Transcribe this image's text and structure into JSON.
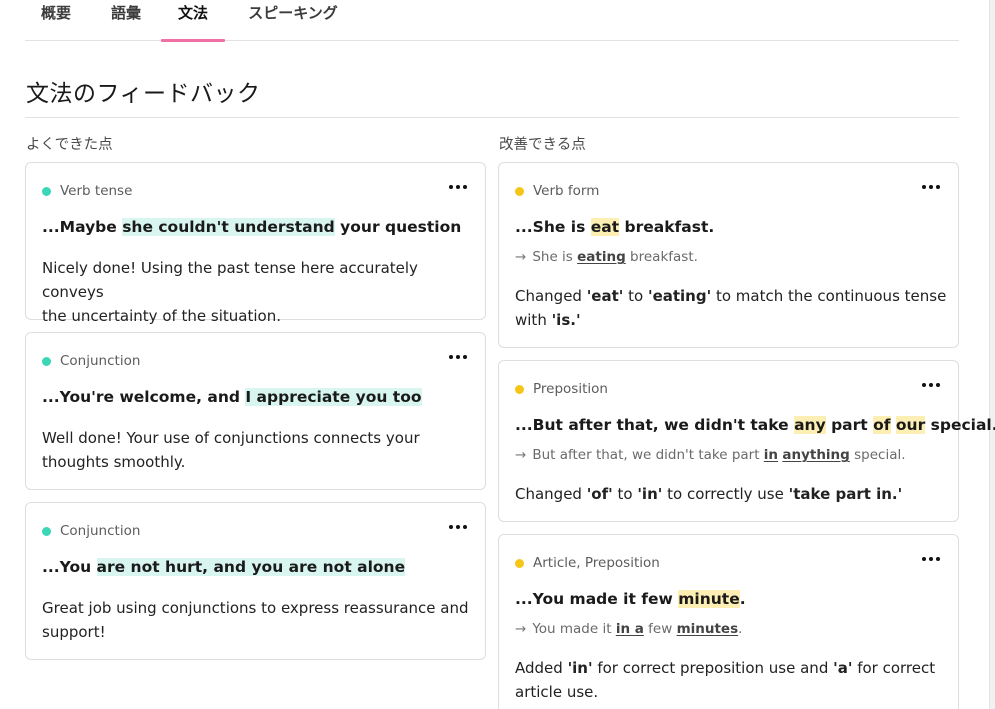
{
  "tabs": [
    "概要",
    "語彙",
    "文法",
    "スピーキング"
  ],
  "active_tab": "文法",
  "page_title": "文法のフィードバック",
  "good_heading": "よくできた点",
  "improve_heading": "改善できる点",
  "good_cards": [
    {
      "category": "Verb tense",
      "quote_prefix": "...Maybe ",
      "quote_highlight": "she couldn't understand",
      "quote_suffix": " your question",
      "feedback_line1": "Nicely done! Using the past tense here accurately conveys",
      "feedback_line2": "the uncertainty of the situation."
    },
    {
      "category": "Conjunction",
      "quote_prefix": "...You're welcome, and ",
      "quote_highlight": "I appreciate you too",
      "quote_suffix": "",
      "feedback_line1": "Well done! Your use of conjunctions connects your",
      "feedback_line2": "thoughts smoothly."
    },
    {
      "category": "Conjunction",
      "quote_prefix": "...You ",
      "quote_highlight": "are not hurt, and you are not alone",
      "quote_suffix": "",
      "feedback_line1": "Great job using conjunctions to express reassurance and",
      "feedback_line2": "support!"
    }
  ],
  "improve_cards": [
    {
      "category": "Verb form",
      "quote": [
        "...She is ",
        "eat",
        " breakfast."
      ],
      "correction": [
        "She is ",
        "eating",
        " breakfast."
      ],
      "feedback_line1": [
        "Changed ",
        "'eat'",
        " to ",
        "'eating'",
        " to match the continuous tense"
      ],
      "feedback_line2": [
        "with ",
        "'is.'"
      ]
    },
    {
      "category": "Preposition",
      "quote": [
        "...But after that, we didn't take ",
        "any",
        " part ",
        "of",
        " ",
        "our",
        " special."
      ],
      "correction": [
        "But after that, we didn't take part ",
        "in",
        " ",
        "anything",
        " special."
      ],
      "feedback_line1": [
        "Changed ",
        "'of'",
        " to ",
        "'in'",
        " to correctly use ",
        "'take part in.'"
      ]
    },
    {
      "category": "Article, Preposition",
      "quote": [
        "...You made it few ",
        "minute",
        "."
      ],
      "correction": [
        "You made it ",
        "in a",
        " few ",
        "minutes",
        "."
      ],
      "feedback_line1": [
        "Added ",
        "'in'",
        " for correct preposition use and ",
        "'a'",
        " for correct"
      ],
      "feedback_line2": [
        "article use."
      ]
    }
  ],
  "colors": {
    "active_tab_underline": "#f06fa4",
    "good_dot": "#3bd6b5",
    "improve_dot": "#f5c518",
    "good_highlight": "#d8f6ef",
    "improve_highlight": "#fdefb3"
  },
  "icons": {
    "more": "more-horizontal-icon",
    "arrow": "arrow-right-icon"
  }
}
